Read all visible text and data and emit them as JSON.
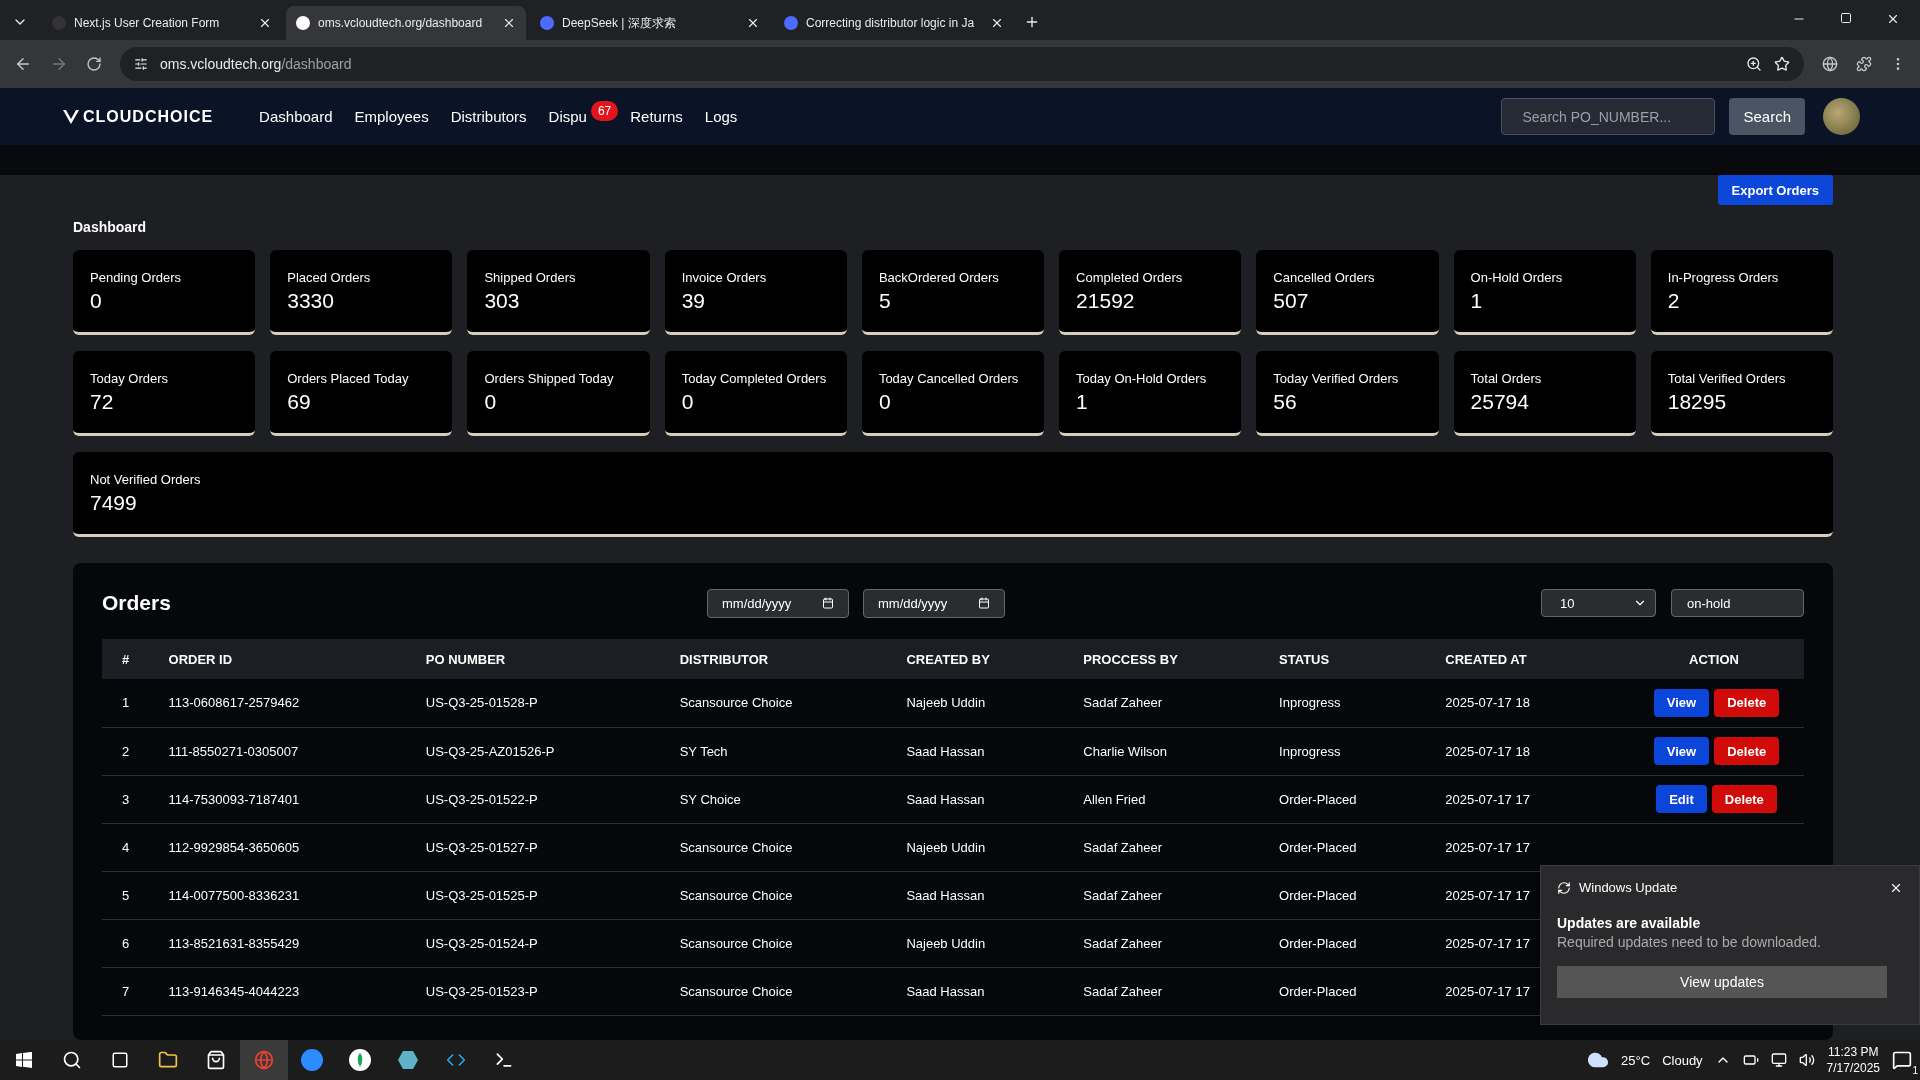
{
  "browser": {
    "tabs": [
      {
        "title": "Next.js User Creation Form",
        "selected": false,
        "kind": "next"
      },
      {
        "title": "oms.vcloudtech.org/dashboard",
        "selected": true,
        "kind": "vercel"
      },
      {
        "title": "DeepSeek | 深度求索",
        "selected": false,
        "kind": "deepseek"
      },
      {
        "title": "Correcting distributor logic in Ja",
        "selected": false,
        "kind": "deepseek"
      }
    ],
    "url": {
      "host": "oms.vcloudtech.org",
      "path": "/dashboard"
    }
  },
  "nav": {
    "brand": "CLOUDCHOICE",
    "links": [
      {
        "label": "Dashboard"
      },
      {
        "label": "Employees"
      },
      {
        "label": "Distributors"
      },
      {
        "label": "Dispu",
        "badge": "67"
      },
      {
        "label": "Returns"
      },
      {
        "label": "Logs"
      }
    ],
    "search": {
      "placeholder": "Search PO_NUMBER..."
    },
    "search_button": "Search"
  },
  "export_button": "Export Orders",
  "heading": "Dashboard",
  "stat_rows": [
    [
      {
        "label": "Pending Orders",
        "value": "0"
      },
      {
        "label": "Placed Orders",
        "value": "3330"
      },
      {
        "label": "Shipped Orders",
        "value": "303"
      },
      {
        "label": "Invoice Orders",
        "value": "39"
      },
      {
        "label": "BackOrdered Orders",
        "value": "5"
      },
      {
        "label": "Completed Orders",
        "value": "21592"
      },
      {
        "label": "Cancelled Orders",
        "value": "507"
      },
      {
        "label": "On-Hold Orders",
        "value": "1"
      },
      {
        "label": "In-Progress Orders",
        "value": "2"
      }
    ],
    [
      {
        "label": "Today Orders",
        "value": "72"
      },
      {
        "label": "Orders Placed Today",
        "value": "69"
      },
      {
        "label": "Orders Shipped Today",
        "value": "0"
      },
      {
        "label": "Today Completed Orders",
        "value": "0"
      },
      {
        "label": "Today Cancelled Orders",
        "value": "0"
      },
      {
        "label": "Today On-Hold Orders",
        "value": "1"
      },
      {
        "label": "Today Verified Orders",
        "value": "56"
      },
      {
        "label": "Total Orders",
        "value": "25794"
      },
      {
        "label": "Total Verified Orders",
        "value": "18295"
      }
    ],
    [
      {
        "label": "Not Verified Orders",
        "value": "7499"
      }
    ]
  ],
  "orders": {
    "title": "Orders",
    "date_from": {
      "placeholder": "mm/dd/yyyy"
    },
    "date_to": {
      "placeholder": "mm/dd/yyyy"
    },
    "page_size": "10",
    "status_filter": {
      "value": "on-hold"
    },
    "columns": [
      "#",
      "ORDER ID",
      "PO NUMBER",
      "DISTRIBUTOR",
      "CREATED BY",
      "PROCCESS BY",
      "STATUS",
      "CREATED AT",
      "ACTION"
    ],
    "rows": [
      {
        "cells": [
          "1",
          "113-0608617-2579462",
          "US-Q3-25-01528-P",
          "Scansource Choice",
          "Najeeb Uddin",
          "Sadaf Zaheer",
          "Inprogress",
          "2025-07-17 18"
        ],
        "actions": [
          {
            "label": "View",
            "kind": "primary"
          },
          {
            "label": "Delete",
            "kind": "danger"
          }
        ]
      },
      {
        "cells": [
          "2",
          "111-8550271-0305007",
          "US-Q3-25-AZ01526-P",
          "SY Tech",
          "Saad Hassan",
          "Charlie Wilson",
          "Inprogress",
          "2025-07-17 18"
        ],
        "actions": [
          {
            "label": "View",
            "kind": "primary"
          },
          {
            "label": "Delete",
            "kind": "danger"
          }
        ]
      },
      {
        "cells": [
          "3",
          "114-7530093-7187401",
          "US-Q3-25-01522-P",
          "SY Choice",
          "Saad Hassan",
          "Allen Fried",
          "Order-Placed",
          "2025-07-17 17"
        ],
        "actions": [
          {
            "label": "Edit",
            "kind": "primary"
          },
          {
            "label": "Delete",
            "kind": "danger"
          }
        ]
      },
      {
        "cells": [
          "4",
          "112-9929854-3650605",
          "US-Q3-25-01527-P",
          "Scansource Choice",
          "Najeeb Uddin",
          "Sadaf Zaheer",
          "Order-Placed",
          "2025-07-17 17"
        ]
      },
      {
        "cells": [
          "5",
          "114-0077500-8336231",
          "US-Q3-25-01525-P",
          "Scansource Choice",
          "Saad Hassan",
          "Sadaf Zaheer",
          "Order-Placed",
          "2025-07-17 17"
        ]
      },
      {
        "cells": [
          "6",
          "113-8521631-8355429",
          "US-Q3-25-01524-P",
          "Scansource Choice",
          "Najeeb Uddin",
          "Sadaf Zaheer",
          "Order-Placed",
          "2025-07-17 17"
        ]
      },
      {
        "cells": [
          "7",
          "113-9146345-4044223",
          "US-Q3-25-01523-P",
          "Scansource Choice",
          "Saad Hassan",
          "Sadaf Zaheer",
          "Order-Placed",
          "2025-07-17 17"
        ]
      }
    ]
  },
  "toast": {
    "app": "Windows Update",
    "title": "Updates are available",
    "body": "Required updates need to be downloaded.",
    "button": "View updates"
  },
  "taskbar": {
    "temperature": "25°C",
    "condition": "Cloudy",
    "time": "11:23 PM",
    "date": "7/17/2025",
    "notifications": "1"
  }
}
